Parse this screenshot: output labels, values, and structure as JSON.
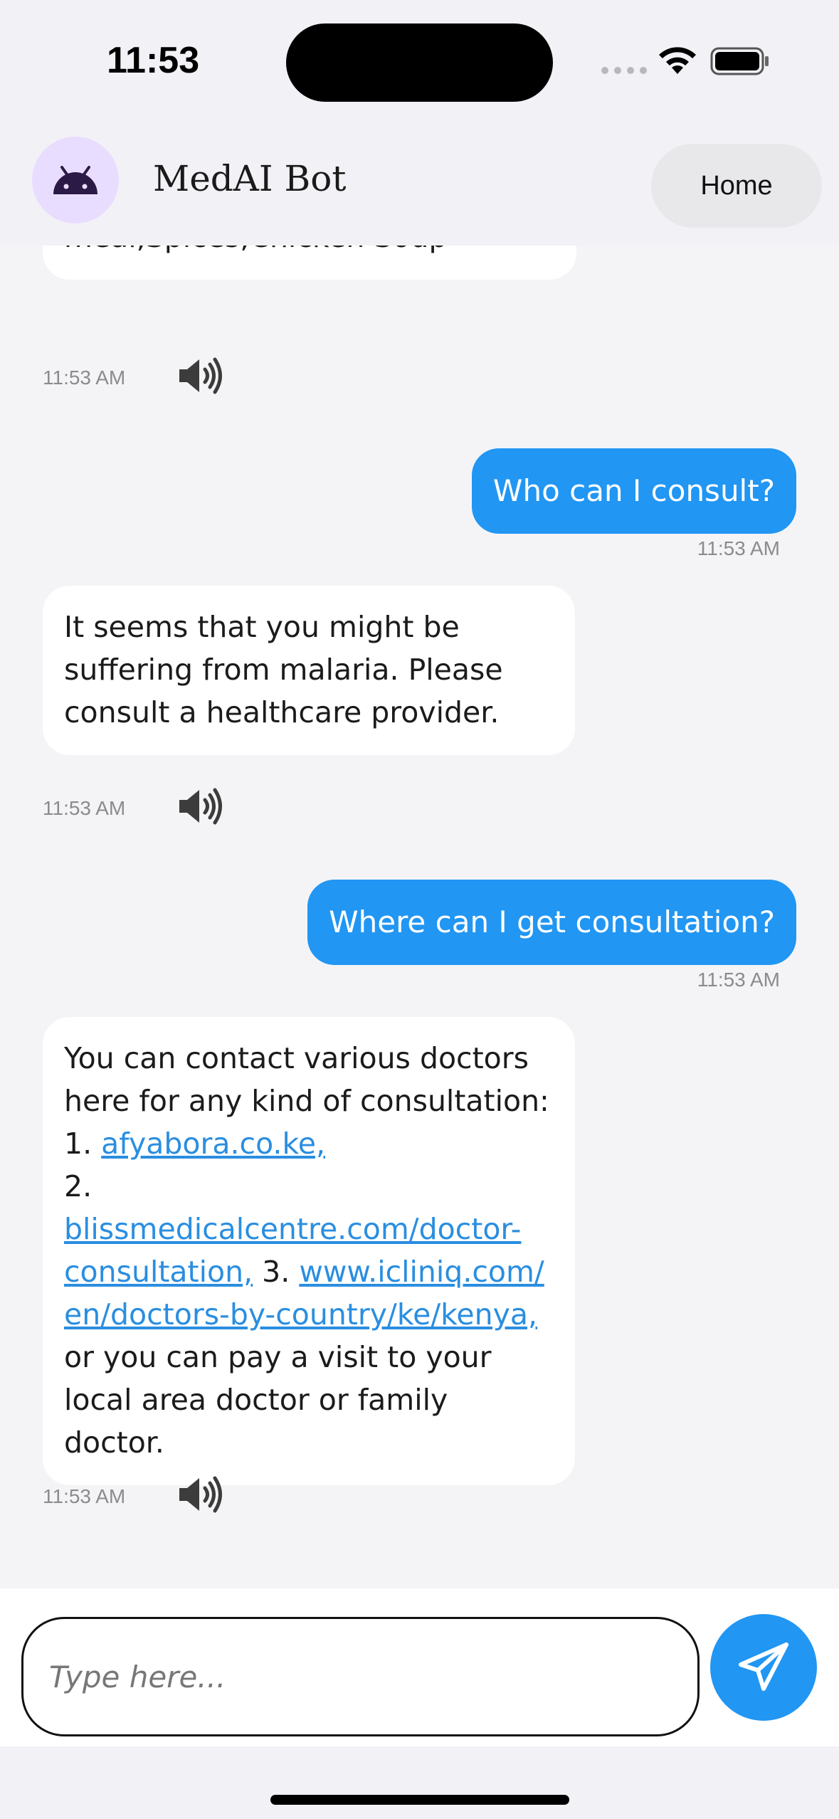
{
  "status_bar": {
    "time": "11:53"
  },
  "header": {
    "title": "MedAI Bot",
    "home_label": "Home"
  },
  "messages": {
    "m1": {
      "text": "fruits,Leafy greens,Broccoli,Oat meal,Spices,Chicken Soup",
      "time": "11:53 AM"
    },
    "m2": {
      "text": "Who can I consult?",
      "time": "11:53 AM"
    },
    "m3": {
      "text": "It seems that you might be suffering from malaria. Please consult a healthcare provider.",
      "time": "11:53 AM"
    },
    "m4": {
      "text": "Where can I get consultation?",
      "time": "11:53 AM"
    },
    "m5": {
      "intro": "You can contact various doctors here for any kind of consultation: 1.",
      "link1": "afyabora.co.ke,",
      "sep2": "2.",
      "link2": "blissmedicalcentre.com/doctor-consultation,",
      "sep3": "3.",
      "link3": "www.icliniq.com/en/doctors-by-country/ke/kenya,",
      "outro": "or you can pay a visit to your local area doctor or family doctor.",
      "time": "11:53 AM"
    }
  },
  "input": {
    "placeholder": "Type here...",
    "value": ""
  },
  "colors": {
    "accent": "#2196f3",
    "avatar_bg": "#e9ddff",
    "link": "#2a8ee0"
  }
}
